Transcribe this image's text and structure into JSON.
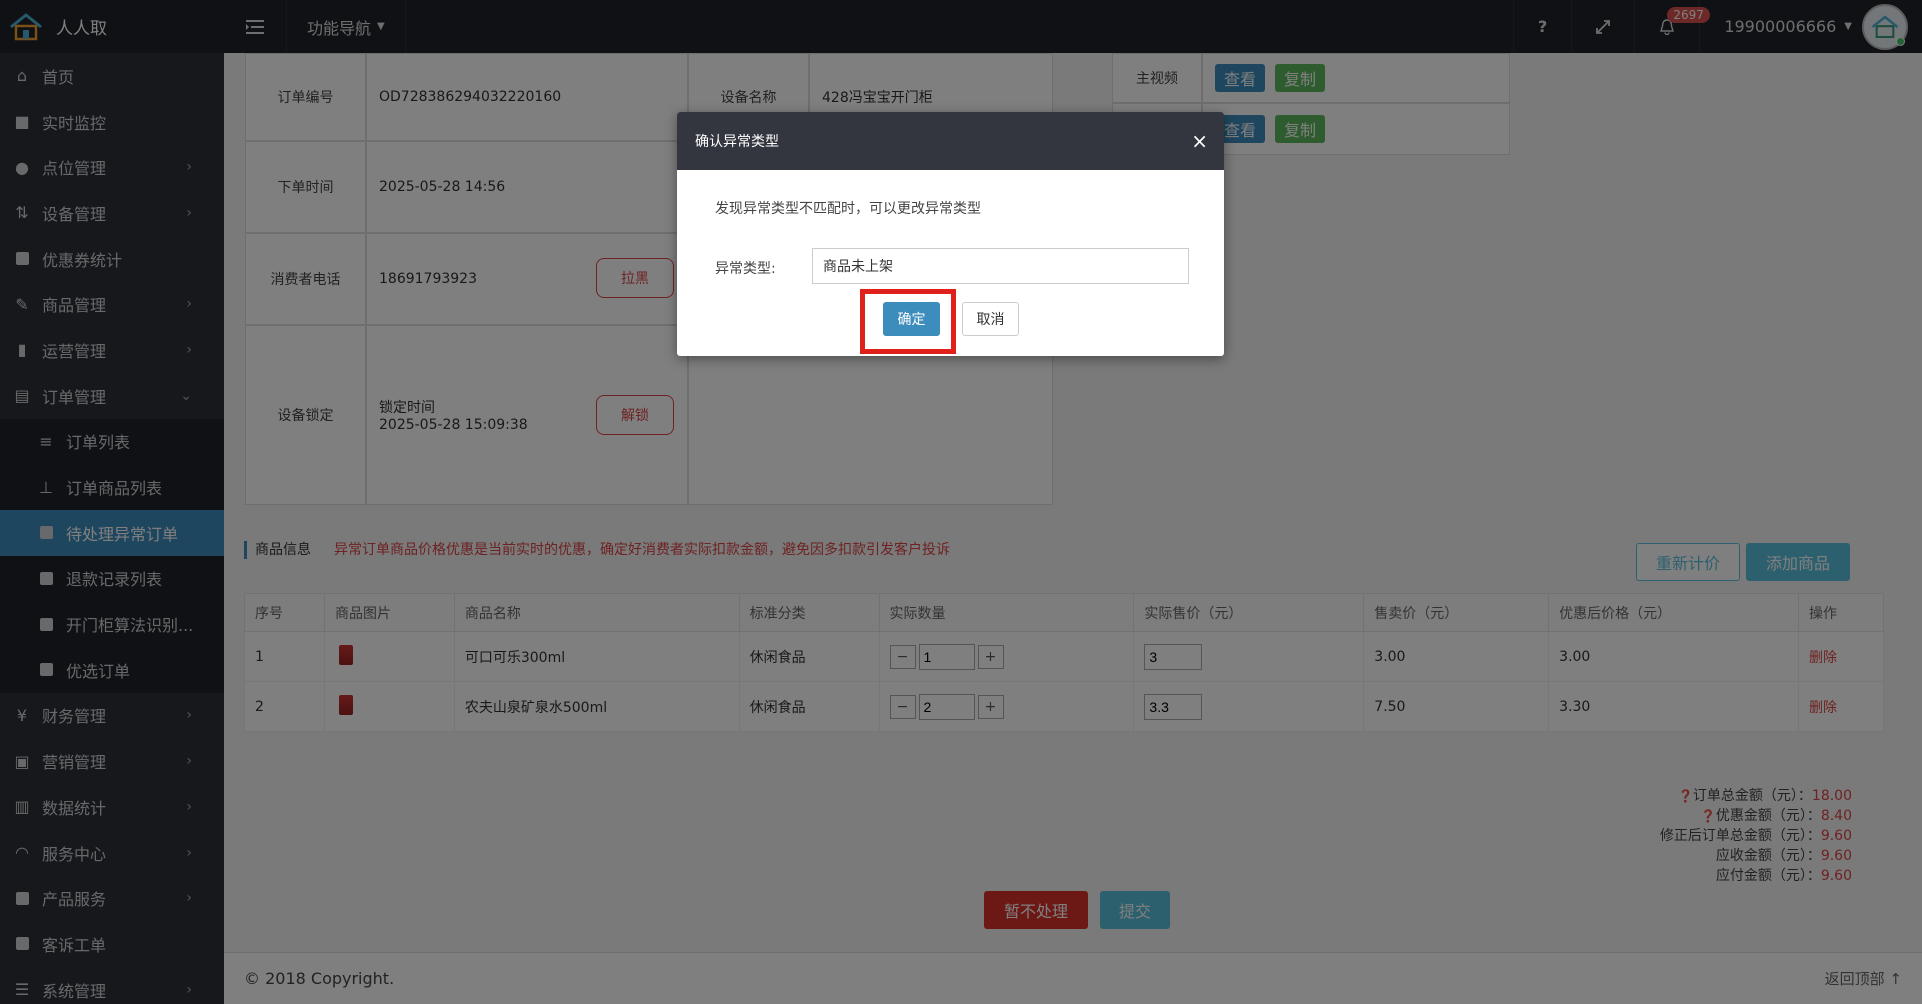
{
  "brand": {
    "name": "人人取"
  },
  "topbar": {
    "nav_label": "功能导航",
    "help_label": "?",
    "notification_count": "2697",
    "user_phone": "19900006666"
  },
  "sidebar": {
    "items": [
      {
        "label": "首页",
        "icon": "home-icon"
      },
      {
        "label": "实时监控",
        "icon": "video-camera-icon"
      },
      {
        "label": "点位管理",
        "icon": "map-marker-icon",
        "arrow": "›"
      },
      {
        "label": "设备管理",
        "icon": "sort-icon",
        "arrow": "›"
      },
      {
        "label": "优惠券统计",
        "icon": "square-icon"
      },
      {
        "label": "商品管理",
        "icon": "edit-icon",
        "arrow": "›"
      },
      {
        "label": "运营管理",
        "icon": "bookmark-icon",
        "arrow": "›"
      },
      {
        "label": "订单管理",
        "icon": "list-alt-icon",
        "arrow": "⌄"
      }
    ],
    "sub_items": [
      {
        "label": "订单列表",
        "icon": "bars-icon"
      },
      {
        "label": "订单商品列表",
        "icon": "sitemap-icon"
      },
      {
        "label": "待处理异常订单",
        "icon": "square-icon"
      },
      {
        "label": "退款记录列表",
        "icon": "square-icon"
      },
      {
        "label": "开门柜算法识别...",
        "icon": "square-icon"
      },
      {
        "label": "优选订单",
        "icon": "square-icon"
      }
    ],
    "items_after": [
      {
        "label": "财务管理",
        "icon": "yen-icon",
        "arrow": "›"
      },
      {
        "label": "营销管理",
        "icon": "shopping-icon",
        "arrow": "›"
      },
      {
        "label": "数据统计",
        "icon": "bar-chart-icon",
        "arrow": "›"
      },
      {
        "label": "服务中心",
        "icon": "headset-icon",
        "arrow": "›"
      },
      {
        "label": "产品服务",
        "icon": "square-icon",
        "arrow": "›"
      },
      {
        "label": "客诉工单",
        "icon": "square-icon"
      },
      {
        "label": "系统管理",
        "icon": "list-icon",
        "arrow": "›"
      }
    ]
  },
  "order": {
    "order_no_label": "订单编号",
    "order_no": "OD728386294032220160",
    "device_name_label": "设备名称",
    "device_name": "428冯宝宝开门柜",
    "order_time_label": "下单时间",
    "order_time": "2025-05-28 14:56",
    "phone_label": "消费者电话",
    "phone": "18691793923",
    "blacklist_label": "拉黑",
    "lock_label": "设备锁定",
    "lock_time_label": "锁定时间",
    "lock_time": "2025-05-28 15:09:38",
    "unlock_label": "解锁",
    "main_video_label": "主视频",
    "view_label": "查看",
    "copy_label": "复制"
  },
  "goods": {
    "section_title": "商品信息",
    "warning": "异常订单商品价格优惠是当前实时的优惠，确定好消费者实际扣款金额，避免因多扣款引发客户投诉",
    "reprice_label": "重新计价",
    "add_label": "添加商品",
    "columns": [
      "序号",
      "商品图片",
      "商品名称",
      "标准分类",
      "实际数量",
      "实际售价（元）",
      "售卖价（元）",
      "优惠后价格（元）",
      "操作"
    ],
    "rows": [
      {
        "no": "1",
        "name": "可口可乐300ml",
        "category": "休闲食品",
        "qty": "1",
        "actual_price": "3",
        "sale_price": "3.00",
        "discount_price": "3.00",
        "action": "删除"
      },
      {
        "no": "2",
        "name": "农夫山泉矿泉水500ml",
        "category": "休闲食品",
        "qty": "2",
        "actual_price": "3.3",
        "sale_price": "7.50",
        "discount_price": "3.30",
        "action": "删除"
      }
    ]
  },
  "totals": [
    {
      "label": "订单总金额（元）：",
      "value": "18.00",
      "help": true
    },
    {
      "label": "优惠金额（元）：",
      "value": "8.40",
      "help": true
    },
    {
      "label": "修正后订单总金额（元）：",
      "value": "9.60",
      "help": false
    },
    {
      "label": "应收金额（元）：",
      "value": "9.60",
      "help": false
    },
    {
      "label": "应付金额（元）：",
      "value": "9.60",
      "help": false
    }
  ],
  "actions": {
    "hold_label": "暂不处理",
    "submit_label": "提交"
  },
  "footer": {
    "copyright": "© 2018 Copyright.",
    "back_top": "返回顶部"
  },
  "modal": {
    "title": "确认异常类型",
    "close": "×",
    "tip": "发现异常类型不匹配时，可以更改异常类型",
    "type_label": "异常类型:",
    "type_value": "商品未上架",
    "ok_label": "确定",
    "cancel_label": "取消"
  },
  "colors": {
    "primary": "#3c8dbc",
    "danger": "#d9534f",
    "success": "#5cb85c",
    "topbar": "#1f2228",
    "sidebar": "#2d3138",
    "highlight": "#e0201a"
  }
}
